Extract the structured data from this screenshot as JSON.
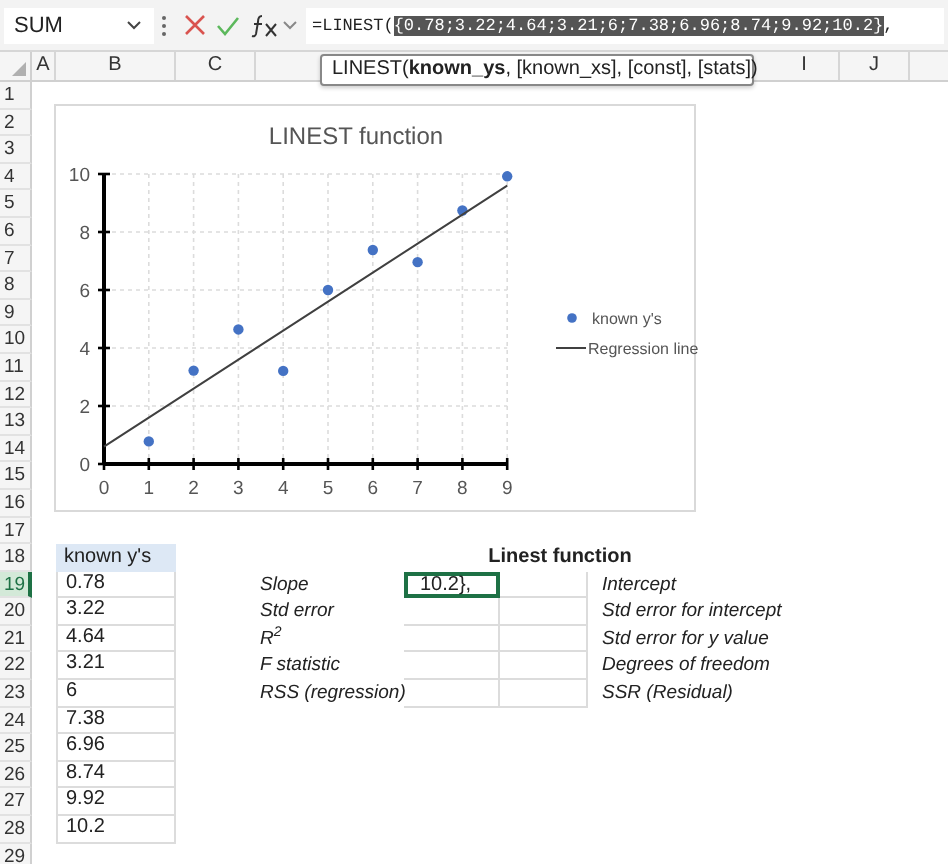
{
  "formula_bar": {
    "name_box": "SUM",
    "formula_prefix": "=LINEST(",
    "formula_selected": "{0.78;3.22;4.64;3.21;6;7.38;6.96;8.74;9.92;10.2}",
    "formula_suffix": ",",
    "tooltip": "LINEST(**known_ys**, [known_xs], [const], [stats])"
  },
  "columns_left": [
    "A",
    "B",
    "C"
  ],
  "columns_right": [
    "I",
    "J"
  ],
  "rows": [
    {
      "label": "1",
      "selected": false
    },
    {
      "label": "2",
      "selected": false
    },
    {
      "label": "3",
      "selected": false
    },
    {
      "label": "4",
      "selected": false
    },
    {
      "label": "5",
      "selected": false
    },
    {
      "label": "6",
      "selected": false
    },
    {
      "label": "7",
      "selected": false
    },
    {
      "label": "8",
      "selected": false
    },
    {
      "label": "9",
      "selected": false
    },
    {
      "label": "10",
      "selected": false
    },
    {
      "label": "11",
      "selected": false
    },
    {
      "label": "12",
      "selected": false
    },
    {
      "label": "13",
      "selected": false
    },
    {
      "label": "14",
      "selected": false
    },
    {
      "label": "15",
      "selected": false
    },
    {
      "label": "16",
      "selected": false
    },
    {
      "label": "17",
      "selected": false
    },
    {
      "label": "18",
      "selected": false
    },
    {
      "label": "19",
      "selected": true
    },
    {
      "label": "20",
      "selected": false
    },
    {
      "label": "21",
      "selected": false
    },
    {
      "label": "22",
      "selected": false
    },
    {
      "label": "23",
      "selected": false
    },
    {
      "label": "24",
      "selected": false
    },
    {
      "label": "25",
      "selected": false
    },
    {
      "label": "26",
      "selected": false
    },
    {
      "label": "27",
      "selected": false
    },
    {
      "label": "28",
      "selected": false
    },
    {
      "label": "29",
      "selected": false
    }
  ],
  "chart": {
    "chart_data": {
      "type": "scatter",
      "title": "LINEST function",
      "x": [
        0,
        1,
        2,
        3,
        4,
        5,
        6,
        7,
        8,
        9
      ],
      "series": [
        {
          "name": "known y's",
          "type": "scatter",
          "color": "#4472c4",
          "values": [
            null,
            0.78,
            3.22,
            4.64,
            3.21,
            6,
            7.38,
            6.96,
            8.74,
            9.92
          ]
        },
        {
          "name": "Regression line",
          "type": "line",
          "color": "#404040",
          "values": [
            0.6,
            1.6,
            2.6,
            3.6,
            4.6,
            5.6,
            6.6,
            7.6,
            8.6,
            9.6
          ]
        }
      ],
      "xlim": [
        0,
        9
      ],
      "ylim": [
        0,
        10
      ],
      "xticks": [
        0,
        1,
        2,
        3,
        4,
        5,
        6,
        7,
        8,
        9
      ],
      "yticks": [
        0,
        2,
        4,
        6,
        8,
        10
      ],
      "grid": true,
      "legend": "right"
    }
  },
  "known_ys": {
    "header": "known y's",
    "values": [
      "0.78",
      "3.22",
      "4.64",
      "3.21",
      "6",
      "7.38",
      "6.96",
      "8.74",
      "9.92",
      "10.2"
    ]
  },
  "linest": {
    "title": "Linest function",
    "active_cell": "10.2},",
    "rows": [
      {
        "label": "Slope",
        "right_label": "Intercept"
      },
      {
        "label": "Std error",
        "right_label": "Std error for intercept"
      },
      {
        "label": "R$^{2}$",
        "right_label": "Std error for y value"
      },
      {
        "label": "F statistic",
        "right_label": "Degrees of freedom"
      },
      {
        "label": "RSS (regression)",
        "right_label": "SSR (Residual)"
      }
    ]
  }
}
